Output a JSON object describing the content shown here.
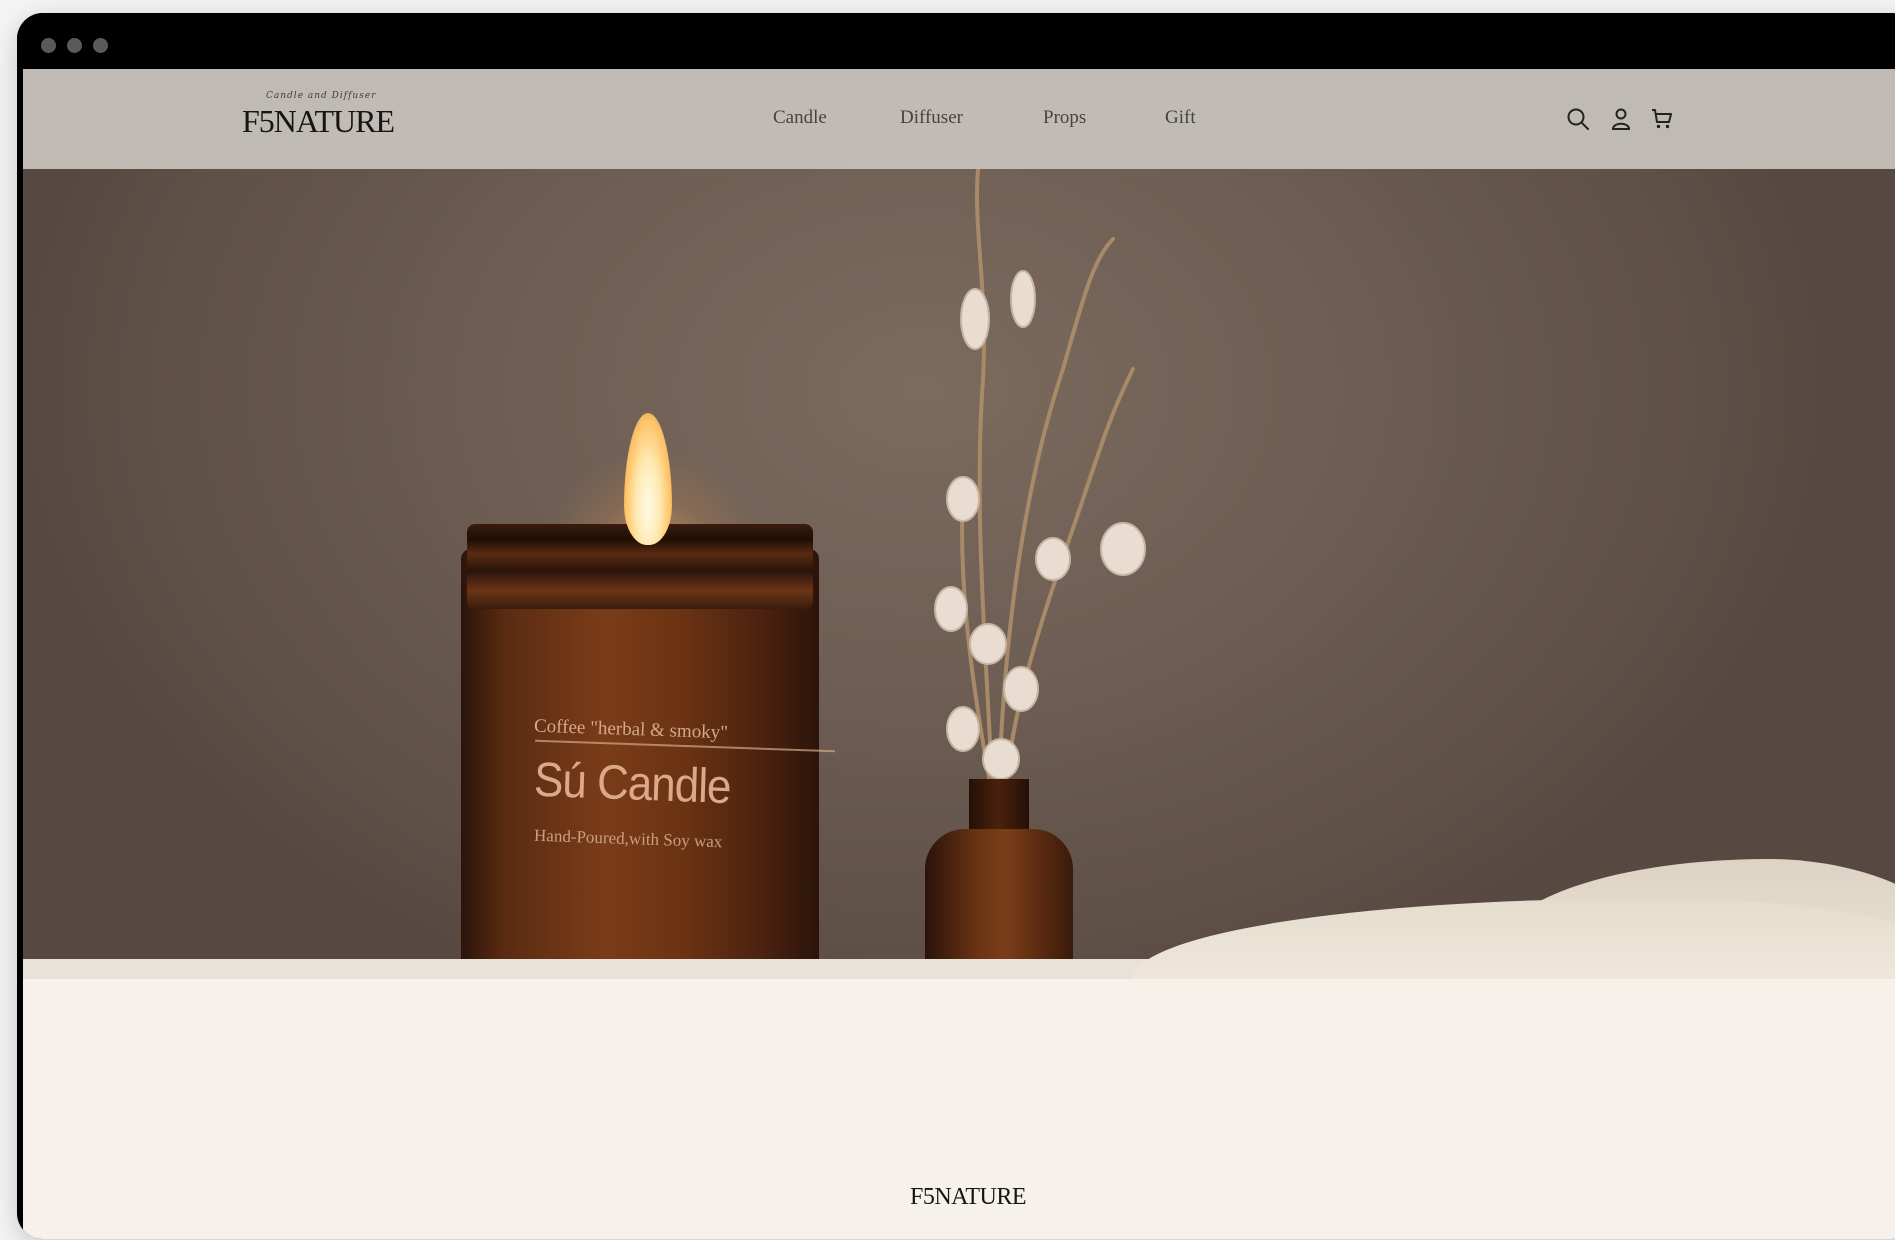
{
  "header": {
    "logo_tagline": "Candle and Diffuser",
    "logo_text": "F5NATURE",
    "nav": [
      "Candle",
      "Diffuser",
      "Props",
      "Gift"
    ]
  },
  "hero": {
    "product_label_top": "Coffee \"herbal & smoky\"",
    "product_brand": "Sú Candle",
    "product_subtitle": "Hand-Poured,with Soy wax"
  },
  "footer": {
    "logo_text": "F5NATURE"
  },
  "icons": [
    "search-icon",
    "user-icon",
    "cart-icon"
  ],
  "colors": {
    "hero_bg": "#6e5e53",
    "nav_bg": "#c9c3be",
    "page_bg": "#f6f1ea",
    "text_dark": "#151515"
  }
}
